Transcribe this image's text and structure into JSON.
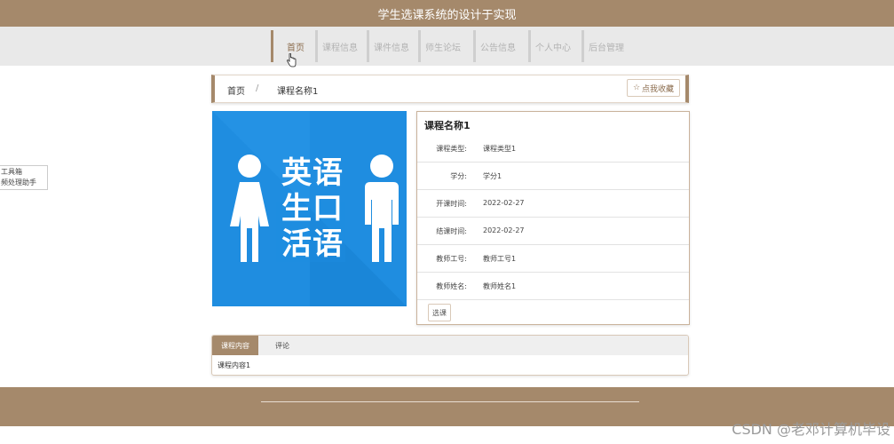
{
  "header": {
    "title": "学生选课系统的设计于实现"
  },
  "nav": {
    "items": [
      {
        "label": "首页"
      },
      {
        "label": "课程信息"
      },
      {
        "label": "课件信息"
      },
      {
        "label": "师生论坛"
      },
      {
        "label": "公告信息"
      },
      {
        "label": "个人中心"
      },
      {
        "label": "后台管理"
      }
    ],
    "active_index": 0
  },
  "float_tool": {
    "line1": "工具箱",
    "line2": "频处理助手"
  },
  "breadcrumb": {
    "home": "首页",
    "separator": "/",
    "current": "课程名称1"
  },
  "favorite_button": {
    "icon": "star-outline-icon",
    "label": "点我收藏"
  },
  "course_image": {
    "text_line1": "英语",
    "text_line2": "生口",
    "text_line3": "活语",
    "bg_color": "#1f8de0"
  },
  "detail": {
    "title": "课程名称1",
    "rows": [
      {
        "label": "课程类型:",
        "value": "课程类型1"
      },
      {
        "label": "学分:",
        "value": "学分1"
      },
      {
        "label": "开课时间:",
        "value": "2022-02-27"
      },
      {
        "label": "结课时间:",
        "value": "2022-02-27"
      },
      {
        "label": "教师工号:",
        "value": "教师工号1"
      },
      {
        "label": "教师姓名:",
        "value": "教师姓名1"
      }
    ],
    "select_button": "选课"
  },
  "tabs": {
    "items": [
      {
        "label": "课程内容"
      },
      {
        "label": "评论"
      }
    ],
    "content": "课程内容1"
  },
  "watermark": "CSDN @老邓计算机毕设",
  "colors": {
    "accent": "#a5896b",
    "nav_bg": "#e9e9e9",
    "image_bg": "#1f8de0"
  }
}
